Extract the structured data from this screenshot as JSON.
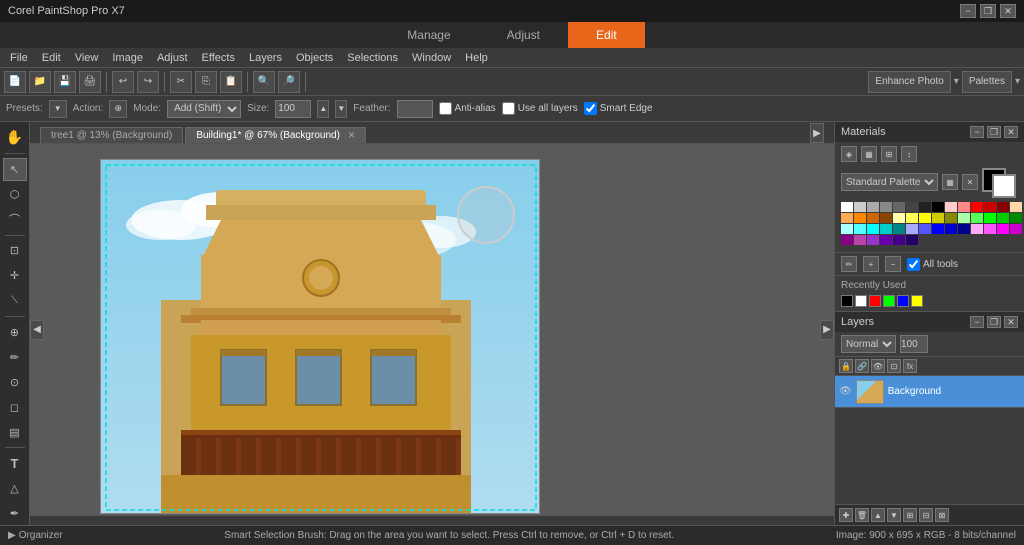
{
  "titleBar": {
    "title": "Corel PaintShop Pro X7",
    "winControls": [
      "−",
      "❐",
      "✕"
    ]
  },
  "modeTabs": [
    {
      "id": "manage",
      "label": "Manage",
      "active": false
    },
    {
      "id": "adjust",
      "label": "Adjust",
      "active": false
    },
    {
      "id": "edit",
      "label": "Edit",
      "active": true
    }
  ],
  "menuBar": {
    "items": [
      "File",
      "Edit",
      "View",
      "Image",
      "Adjust",
      "Effects",
      "Layers",
      "Objects",
      "Selections",
      "Window",
      "Help"
    ]
  },
  "toolbar": {
    "enhancePhoto": "Enhance Photo",
    "palettes": "Palettes"
  },
  "selToolbar": {
    "presetsLabel": "Presets:",
    "actionLabel": "Action:",
    "modeLabel": "Mode:",
    "modeValue": "Add (Shift)",
    "sizeLabel": "Size:",
    "sizeValue": "100",
    "featherLabel": "Feather:",
    "antiAlias": "Anti-alias",
    "useAllLayers": "Use all layers",
    "smartEdge": "Smart Edge"
  },
  "tabs": [
    {
      "id": "tree1",
      "label": "tree1 @ 13% (Background)",
      "active": false,
      "closeable": false
    },
    {
      "id": "building1",
      "label": "Building1* @ 67% (Background)",
      "active": true,
      "closeable": true
    }
  ],
  "tools": [
    {
      "id": "pan",
      "icon": "✋",
      "active": false
    },
    {
      "id": "arrow",
      "icon": "↖",
      "active": false
    },
    {
      "id": "select",
      "icon": "⊹",
      "active": true
    },
    {
      "id": "lasso",
      "icon": "⌒",
      "active": false
    },
    {
      "id": "magic",
      "icon": "⚡",
      "active": false
    },
    {
      "id": "crop",
      "icon": "⊡",
      "active": false
    },
    {
      "id": "move",
      "icon": "✛",
      "active": false
    },
    {
      "id": "straighten",
      "icon": "⌇",
      "active": false
    },
    {
      "id": "red-eye",
      "icon": "⊕",
      "active": false
    },
    {
      "id": "paint",
      "icon": "✏",
      "active": false
    },
    {
      "id": "clone",
      "icon": "⊙",
      "active": false
    },
    {
      "id": "eraser",
      "icon": "◻",
      "active": false
    },
    {
      "id": "fill",
      "icon": "▤",
      "active": false
    },
    {
      "id": "text",
      "icon": "T",
      "active": false
    },
    {
      "id": "shapes",
      "icon": "△",
      "active": false
    },
    {
      "id": "pen",
      "icon": "✒",
      "active": false
    }
  ],
  "materials": {
    "title": "Materials",
    "paletteLabel": "Standard Palette",
    "fgColor": "#000000",
    "bgColor": "#ffffff",
    "swatches": [
      "#ffffff",
      "#cccccc",
      "#aaaaaa",
      "#888888",
      "#666666",
      "#444444",
      "#222222",
      "#000000",
      "#ffcccc",
      "#ff8888",
      "#ff0000",
      "#cc0000",
      "#880000",
      "#ffd5aa",
      "#ffaa55",
      "#ff8800",
      "#cc6600",
      "#884400",
      "#ffffaa",
      "#ffff55",
      "#ffff00",
      "#cccc00",
      "#888800",
      "#aaffaa",
      "#55ff55",
      "#00ff00",
      "#00cc00",
      "#008800",
      "#aaffff",
      "#55ffff",
      "#00ffff",
      "#00cccc",
      "#008888",
      "#aaaaff",
      "#5555ff",
      "#0000ff",
      "#0000cc",
      "#000088",
      "#ffaaff",
      "#ff55ff",
      "#ff00ff",
      "#cc00cc",
      "#880088",
      "#bb44aa",
      "#9933cc",
      "#6600aa",
      "#440088",
      "#220066"
    ],
    "recentlyUsedLabel": "Recently Used",
    "recentColors": [
      "#000000",
      "#ffffff",
      "#ff0000",
      "#00ff00",
      "#0000ff",
      "#ffff00"
    ],
    "allToolsLabel": "All tools"
  },
  "layers": {
    "title": "Layers",
    "blendMode": "Normal",
    "opacity": "100",
    "icons": [
      "🔒",
      "🔗",
      "⊡",
      "⊠"
    ],
    "items": [
      {
        "id": "background",
        "name": "Background",
        "active": true
      }
    ],
    "bottomIcons": [
      "✚",
      "🗑",
      "▼",
      "▲",
      "⊡",
      "⊞",
      "⊠",
      "⊟"
    ]
  },
  "statusBar": {
    "organizer": "Organizer",
    "message": "Smart Selection Brush: Drag on the area you want to select. Press Ctrl to remove, or Ctrl + D to reset.",
    "imageInfo": "Image: 900 x 695 x RGB - 8 bits/channel"
  }
}
